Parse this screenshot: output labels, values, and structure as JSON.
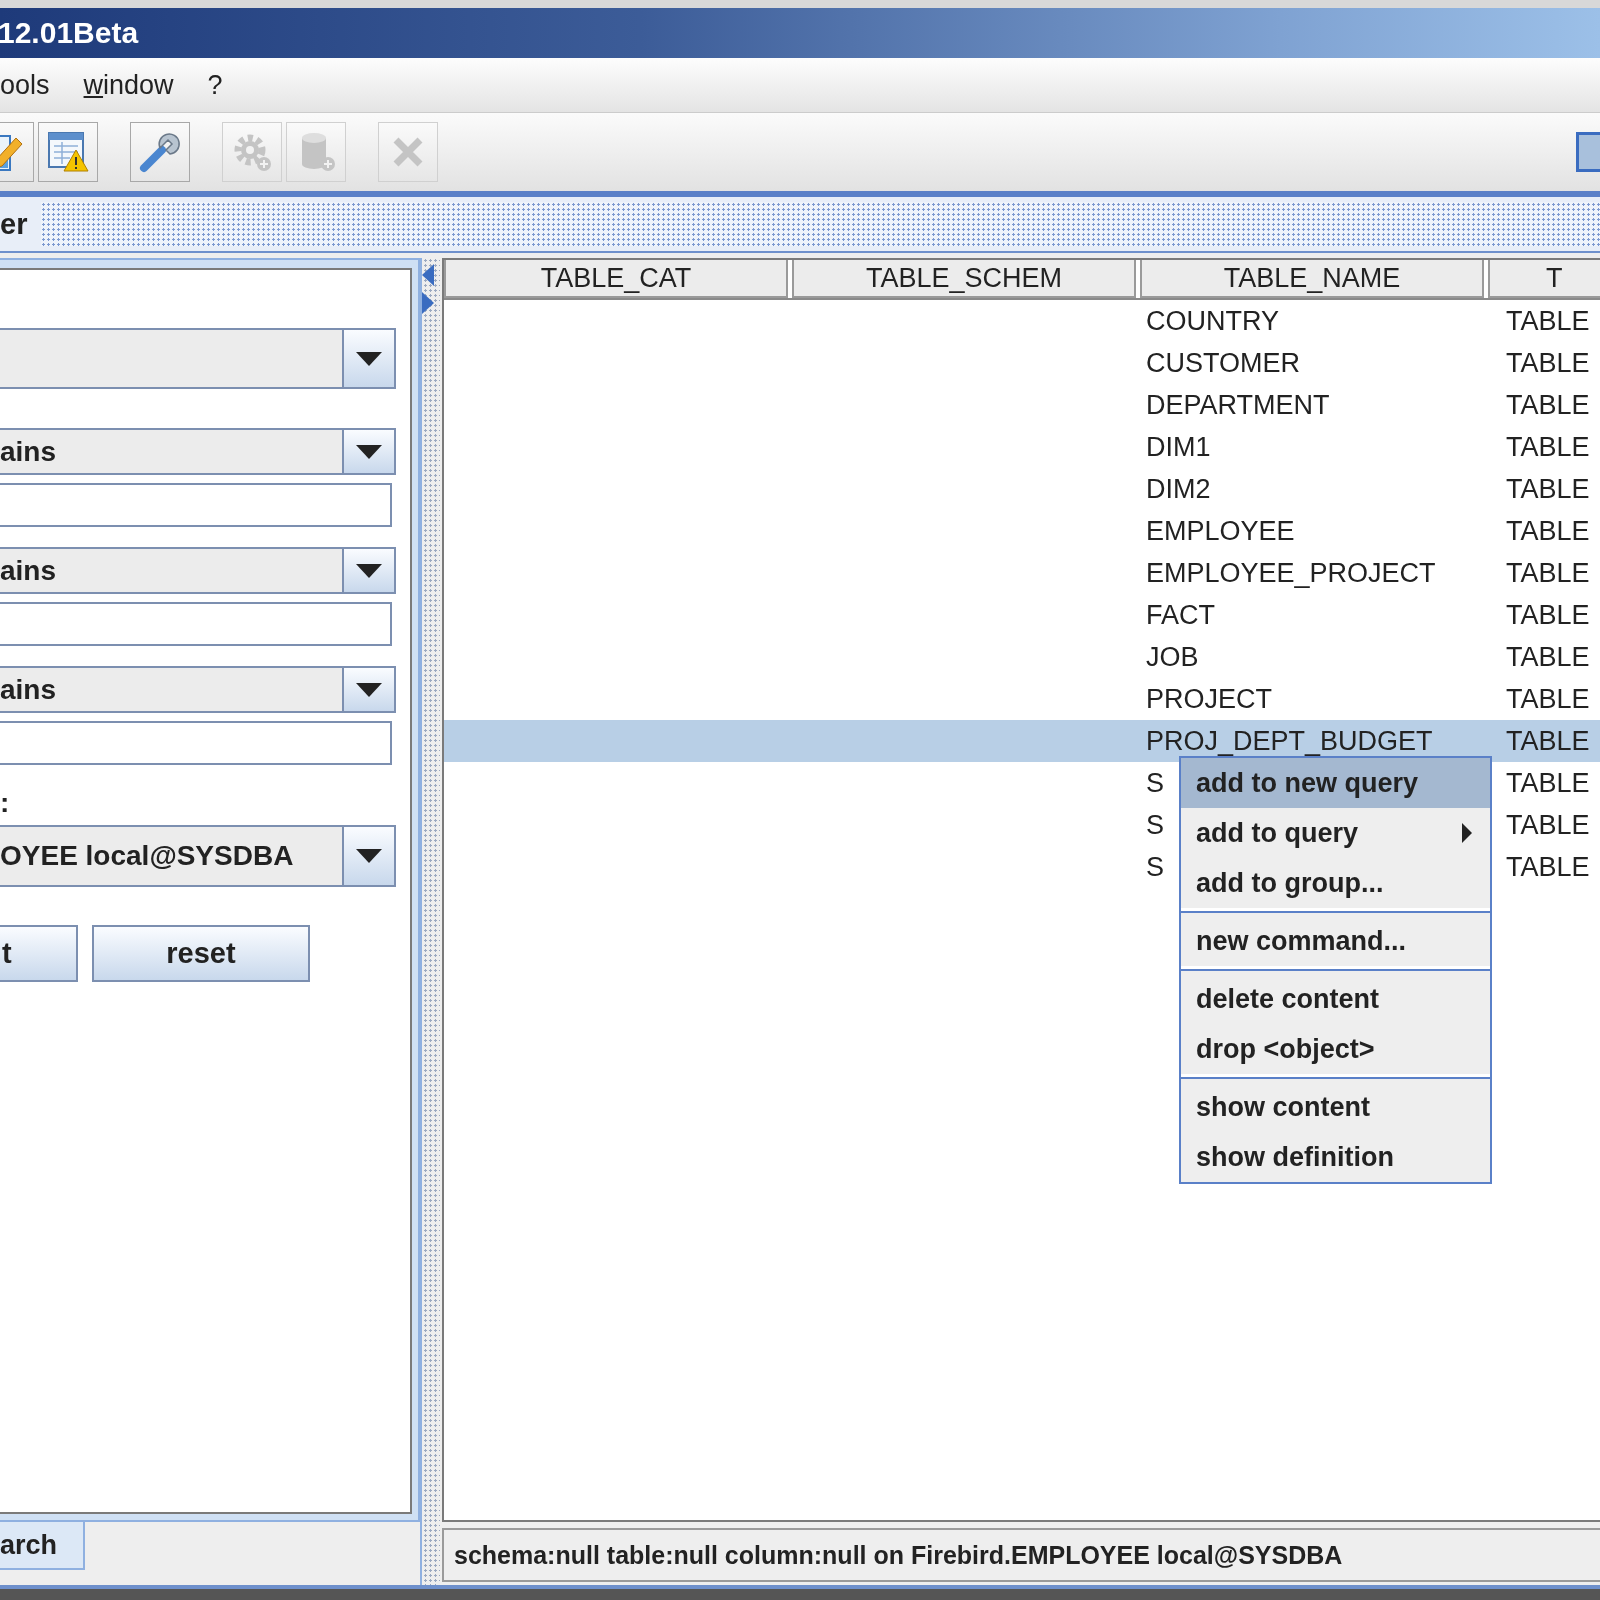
{
  "window": {
    "title": "12.01Beta"
  },
  "menu": [
    {
      "label": "ools",
      "mnemonic_first": false
    },
    {
      "label": "window",
      "mnemonic_first": true
    },
    {
      "label": "?",
      "mnemonic_first": false
    }
  ],
  "toolbar": [
    {
      "kind": "edit",
      "disabled": false
    },
    {
      "kind": "report",
      "disabled": false
    },
    {
      "kind": "separator"
    },
    {
      "kind": "wrench",
      "disabled": false
    },
    {
      "kind": "separator"
    },
    {
      "kind": "gear",
      "disabled": true
    },
    {
      "kind": "database",
      "disabled": true
    },
    {
      "kind": "separator"
    },
    {
      "kind": "delete",
      "disabled": true
    },
    {
      "kind": "layout",
      "disabled": false
    }
  ],
  "panel_title": "er",
  "filter_panel": [
    {
      "kind": "combo"
    },
    {
      "kind": "combo",
      "value": "ains"
    },
    {
      "kind": "field"
    },
    {
      "kind": "combo",
      "value": "ains"
    },
    {
      "kind": "field"
    },
    {
      "kind": "combo",
      "value": "ains"
    },
    {
      "kind": "field"
    },
    {
      "kind": "label",
      "text": ":"
    },
    {
      "kind": "combo",
      "value": "OYEE local@SYSDBA"
    },
    {
      "kind": "buttons",
      "labels": [
        "t",
        "reset"
      ]
    }
  ],
  "bottom_tab": {
    "label": "arch",
    "selected": true
  },
  "table": {
    "columns": [
      "TABLE_CAT",
      "TABLE_SCHEM",
      "TABLE_NAME",
      "T"
    ],
    "rows": [
      {
        "name": "COUNTRY",
        "type": "TABLE",
        "selected": false
      },
      {
        "name": "CUSTOMER",
        "type": "TABLE",
        "selected": false
      },
      {
        "name": "DEPARTMENT",
        "type": "TABLE",
        "selected": false
      },
      {
        "name": "DIM1",
        "type": "TABLE",
        "selected": false
      },
      {
        "name": "DIM2",
        "type": "TABLE",
        "selected": false
      },
      {
        "name": "EMPLOYEE",
        "type": "TABLE",
        "selected": false
      },
      {
        "name": "EMPLOYEE_PROJECT",
        "type": "TABLE",
        "selected": false
      },
      {
        "name": "FACT",
        "type": "TABLE",
        "selected": false
      },
      {
        "name": "JOB",
        "type": "TABLE",
        "selected": false
      },
      {
        "name": "PROJECT",
        "type": "TABLE",
        "selected": false
      },
      {
        "name": "PROJ_DEPT_BUDGET",
        "type": "TABLE",
        "selected": true
      },
      {
        "name": "S",
        "type": "TABLE",
        "selected": false
      },
      {
        "name": "S",
        "type": "TABLE",
        "selected": false
      },
      {
        "name": "S",
        "type": "TABLE",
        "selected": false
      }
    ]
  },
  "context_menu": [
    [
      {
        "label": "add to new query",
        "selected": true,
        "submenu": false
      },
      {
        "label": "add to query",
        "selected": false,
        "submenu": true
      },
      {
        "label": "add to group...",
        "selected": false,
        "submenu": false
      }
    ],
    [
      {
        "label": "new command...",
        "selected": false,
        "submenu": false
      }
    ],
    [
      {
        "label": "delete content",
        "selected": false,
        "submenu": false
      },
      {
        "label": "drop <object>",
        "selected": false,
        "submenu": false
      }
    ],
    [
      {
        "label": "show content",
        "selected": false,
        "submenu": false
      },
      {
        "label": "show definition",
        "selected": false,
        "submenu": false
      }
    ]
  ],
  "status_bar": "schema:null table:null column:null on Firebird.EMPLOYEE local@SYSDBA"
}
